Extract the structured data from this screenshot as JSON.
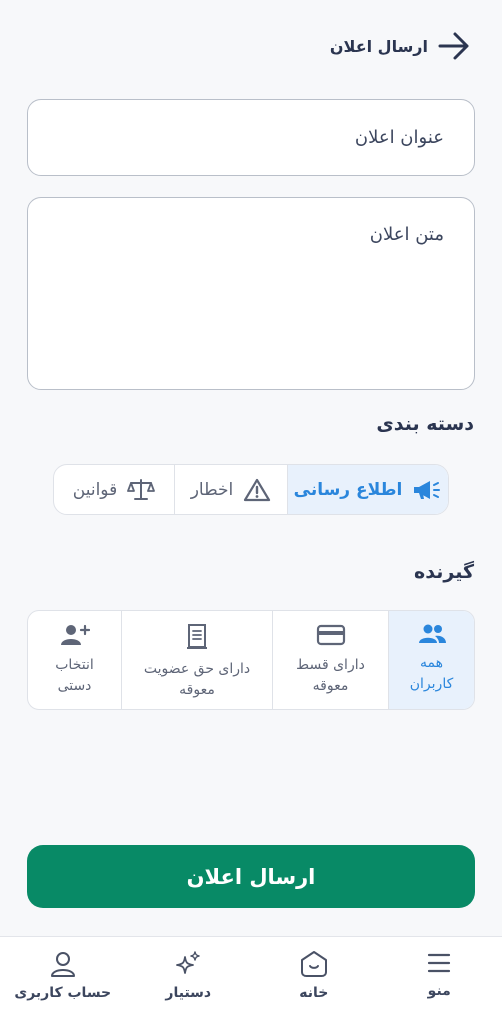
{
  "header": {
    "title": "ارسال اعلان"
  },
  "form": {
    "title_placeholder": "عنوان اعلان",
    "body_placeholder": "متن اعلان"
  },
  "category": {
    "label": "دسته بندی",
    "options": [
      {
        "label": "اطلاع رسانی",
        "icon": "megaphone-icon",
        "selected": true
      },
      {
        "label": "اخطار",
        "icon": "warning-icon",
        "selected": false
      },
      {
        "label": "قوانین",
        "icon": "scales-icon",
        "selected": false
      }
    ]
  },
  "recipients": {
    "label": "گیرنده",
    "options": [
      {
        "line1": "همه",
        "line2": "کاربران",
        "icon": "users-icon",
        "selected": true
      },
      {
        "line1": "دارای قسط",
        "line2": "معوقه",
        "icon": "credit-card-icon",
        "selected": false
      },
      {
        "line1": "دارای حق عضویت",
        "line2": "معوقه",
        "icon": "receipt-icon",
        "selected": false
      },
      {
        "line1": "انتخاب",
        "line2": "دستی",
        "icon": "add-user-icon",
        "selected": false
      }
    ]
  },
  "submit_label": "ارسال اعلان",
  "nav": {
    "items": [
      {
        "label": "منو",
        "icon": "menu-icon"
      },
      {
        "label": "خانه",
        "icon": "home-icon"
      },
      {
        "label": "دستیار",
        "icon": "sparkle-icon"
      },
      {
        "label": "حساب کاربری",
        "icon": "user-icon"
      }
    ]
  },
  "colors": {
    "accent": "#2a86dc",
    "primary": "#088a66",
    "selected_bg": "#e8f1fc"
  }
}
